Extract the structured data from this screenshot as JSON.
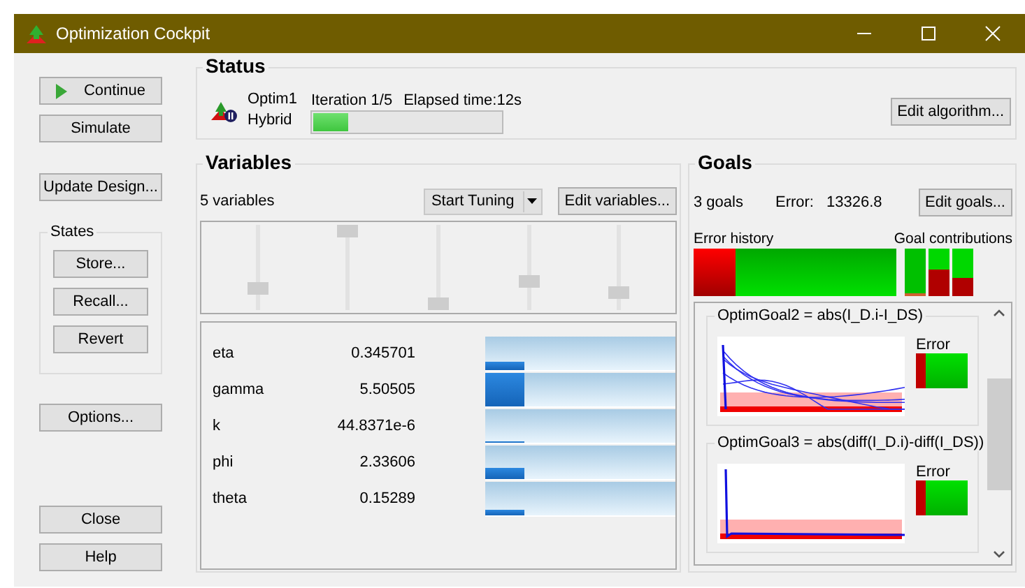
{
  "window": {
    "title": "Optimization Cockpit"
  },
  "sidebar": {
    "top_buttons": [
      {
        "label": "Continue",
        "kind": "play"
      },
      {
        "label": "Simulate",
        "kind": "plain"
      }
    ],
    "update_button": "Update Design...",
    "states": {
      "title": "States",
      "buttons": [
        "Store...",
        "Recall...",
        "Revert"
      ]
    },
    "options_button": "Options...",
    "bottom_buttons": [
      "Close",
      "Help"
    ]
  },
  "status": {
    "title": "Status",
    "optimizer": "Optim1",
    "method": "Hybrid",
    "iteration": "Iteration 1/5",
    "elapsed": "Elapsed time:12s",
    "progress": {
      "level": 0.18
    },
    "edit_button": "Edit algorithm..."
  },
  "variables": {
    "title": "Variables",
    "count": "5 variables",
    "tuning_button": "Start Tuning",
    "edit_button": "Edit variables...",
    "items": [
      {
        "name": "eta",
        "value": "0.345701",
        "level": 0.22
      },
      {
        "name": "gamma",
        "value": "5.50505",
        "level": 1
      },
      {
        "name": "k",
        "value": "44.8371e-6",
        "level": 0
      },
      {
        "name": "phi",
        "value": "2.33606",
        "level": 0.3
      },
      {
        "name": "theta",
        "value": "0.15289",
        "level": 0.15
      }
    ]
  },
  "goals": {
    "title": "Goals",
    "count": "3 goals",
    "error_label": "Error:",
    "error_value": "13326.8",
    "edit_button": "Edit goals...",
    "history_label": "Error history",
    "contributions_label": "Goal contributions",
    "items": [
      {
        "expression": "OptimGoal2 = abs(I_D.i-I_DS)",
        "error_label": "Error"
      },
      {
        "expression": "OptimGoal3 = abs(diff(I_D.i)-diff(I_DS))",
        "error_label": "Error"
      }
    ]
  }
}
